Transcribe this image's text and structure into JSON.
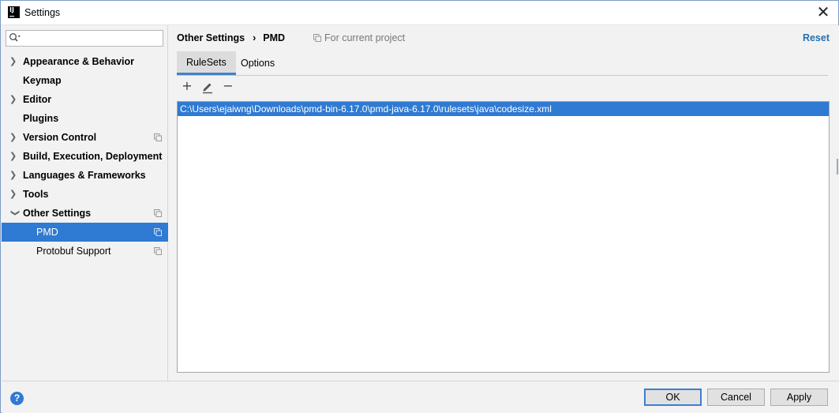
{
  "window": {
    "title": "Settings",
    "app_icon_text": "IJ"
  },
  "sidebar": {
    "search": {
      "value": "",
      "placeholder": ""
    },
    "items": [
      {
        "label": "Appearance & Behavior",
        "expandable": true
      },
      {
        "label": "Keymap",
        "expandable": false
      },
      {
        "label": "Editor",
        "expandable": true
      },
      {
        "label": "Plugins",
        "expandable": false
      },
      {
        "label": "Version Control",
        "expandable": true
      },
      {
        "label": "Build, Execution, Deployment",
        "expandable": true
      },
      {
        "label": "Languages & Frameworks",
        "expandable": true
      },
      {
        "label": "Tools",
        "expandable": true
      },
      {
        "label": "Other Settings",
        "expandable": true,
        "expanded": true
      },
      {
        "label": "PMD",
        "selected": true
      },
      {
        "label": "Protobuf Support"
      }
    ]
  },
  "main": {
    "breadcrumb": {
      "parent": "Other Settings",
      "separator": "›",
      "current": "PMD"
    },
    "scope_label": "For current project",
    "reset_label": "Reset",
    "tabs": [
      {
        "label": "RuleSets",
        "active": true
      },
      {
        "label": "Options",
        "active": false
      }
    ],
    "toolbar": {
      "add": "+",
      "remove": "−"
    },
    "rulesets": [
      "C:\\Users\\ejaiwng\\Downloads\\pmd-bin-6.17.0\\pmd-java-6.17.0\\rulesets\\java\\codesize.xml"
    ]
  },
  "footer": {
    "help_label": "?",
    "ok_label": "OK",
    "cancel_label": "Cancel",
    "apply_label": "Apply"
  },
  "colors": {
    "selection": "#2f7ad2",
    "link": "#2470b3",
    "tab_underline": "#4083c9"
  }
}
